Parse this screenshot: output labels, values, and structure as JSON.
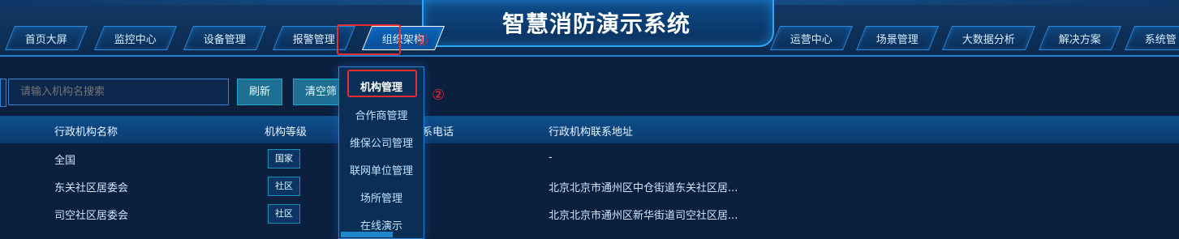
{
  "app": {
    "title": "智慧消防演示系统"
  },
  "nav": {
    "left": [
      {
        "label": "首页大屏",
        "active": false
      },
      {
        "label": "监控中心",
        "active": false
      },
      {
        "label": "设备管理",
        "active": false
      },
      {
        "label": "报警管理",
        "active": false
      },
      {
        "label": "组织架构",
        "active": true
      }
    ],
    "right": [
      {
        "label": "运营中心"
      },
      {
        "label": "场景管理"
      },
      {
        "label": "大数据分析"
      },
      {
        "label": "解决方案"
      },
      {
        "label": "系统管"
      }
    ]
  },
  "annotations": {
    "step1": "①",
    "step2": "②"
  },
  "search": {
    "placeholder": "请输入机构名搜索"
  },
  "buttons": {
    "refresh": "刷新",
    "clear": "清空筛"
  },
  "dropdown": {
    "items": [
      {
        "label": "机构管理",
        "active": true
      },
      {
        "label": "合作商管理"
      },
      {
        "label": "维保公司管理"
      },
      {
        "label": "联网单位管理"
      },
      {
        "label": "场所管理"
      },
      {
        "label": "在线演示"
      }
    ]
  },
  "table": {
    "columns": [
      "行政机构名称",
      "机构等级",
      "系电话",
      "行政机构联系地址"
    ],
    "rows": [
      {
        "name": "全国",
        "level": "国家",
        "address": "-"
      },
      {
        "name": "东关社区居委会",
        "level": "社区",
        "address": "北京北京市通州区中仓街道东关社区居..."
      },
      {
        "name": "司空社区居委会",
        "level": "社区",
        "address": "北京北京市通州区新华街道司空社区居..."
      }
    ]
  },
  "colors": {
    "accent": "#2aa7ff",
    "highlight": "#e62e2e",
    "background": "#0b1f3f"
  }
}
